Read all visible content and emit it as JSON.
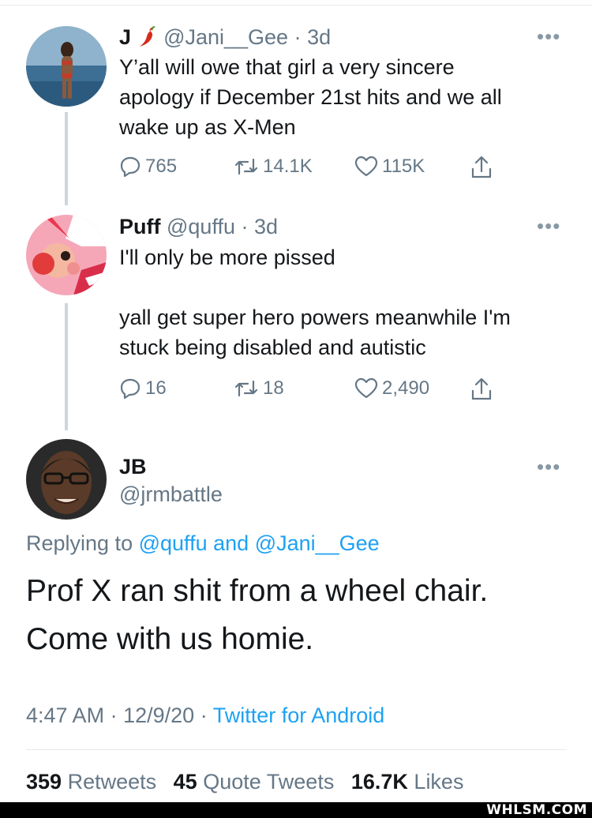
{
  "tweets": [
    {
      "name": "J",
      "name_emoji": "chili-pepper-emoji",
      "handle": "@Jani__Gee",
      "separator": "·",
      "time": "3d",
      "more": "•••",
      "lines": [
        "Y’all will owe that girl a very sincere",
        "apology if December 21st hits and we all",
        "wake up as X-Men"
      ],
      "replies": "765",
      "retweets": "14.1K",
      "likes": "115K"
    },
    {
      "name": "Puff",
      "handle": "@quffu",
      "separator": "·",
      "time": "3d",
      "more": "•••",
      "line1": "I'll only be more pissed",
      "lines": [
        "yall get super hero powers meanwhile I'm",
        "stuck being disabled and autistic"
      ],
      "replies": "16",
      "retweets": "18",
      "likes": "2,490"
    }
  ],
  "main": {
    "name": "JB",
    "handle": "@jrmbattle",
    "more": "•••",
    "replying_prefix": "Replying to",
    "mention1": "@quffu",
    "and": "and",
    "mention2": "@Jani__Gee",
    "text_line1": "Prof X ran shit from a wheel chair.",
    "text_line2": "Come with us homie.",
    "time": "4:47 AM",
    "date": "12/9/20",
    "separator": "·",
    "source": "Twitter for Android",
    "stats": {
      "retweets_count": "359",
      "retweets_label": "Retweets",
      "quotes_count": "45",
      "quotes_label": "Quote Tweets",
      "likes_count": "16.7K",
      "likes_label": "Likes"
    }
  },
  "watermark": "WHLSM.COM",
  "colors": {
    "link": "#1da1f2",
    "muted": "#657786",
    "text": "#14171a",
    "thread_line": "#ccd6dd"
  },
  "icons": [
    "reply-icon",
    "retweet-icon",
    "like-icon",
    "share-icon",
    "more-icon"
  ]
}
